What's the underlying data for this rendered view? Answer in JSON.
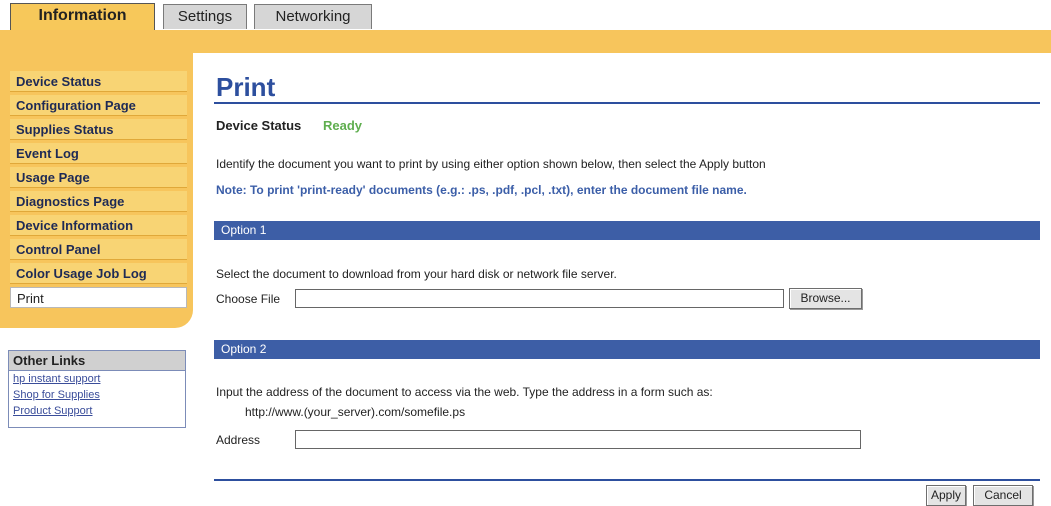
{
  "tabs": [
    {
      "label": "Information",
      "active": true
    },
    {
      "label": "Settings",
      "active": false
    },
    {
      "label": "Networking",
      "active": false
    }
  ],
  "sidebar": {
    "items": [
      {
        "label": "Device Status"
      },
      {
        "label": "Configuration Page"
      },
      {
        "label": "Supplies Status"
      },
      {
        "label": "Event Log"
      },
      {
        "label": "Usage Page"
      },
      {
        "label": "Diagnostics Page"
      },
      {
        "label": "Device Information"
      },
      {
        "label": "Control Panel"
      },
      {
        "label": "Color Usage Job Log"
      },
      {
        "label": "Print",
        "current": true
      }
    ]
  },
  "other_links": {
    "heading": "Other Links",
    "links": [
      "hp instant support",
      "Shop for Supplies",
      "Product Support"
    ]
  },
  "page": {
    "title": "Print",
    "status_label": "Device Status",
    "status_value": "Ready",
    "instructions": "Identify the document you want to print by using either option shown below, then select the Apply button",
    "note": "Note: To print 'print-ready' documents (e.g.: .ps, .pdf, .pcl, .txt), enter the document file name."
  },
  "option1": {
    "heading": "Option 1",
    "description": "Select the document to download from your hard disk or network file server.",
    "file_label": "Choose File",
    "file_value": "",
    "browse_label": "Browse..."
  },
  "option2": {
    "heading": "Option 2",
    "description": "Input the address of the document to access via the web. Type the address in a form such as:",
    "example": "http://www.(your_server).com/somefile.ps",
    "address_label": "Address",
    "address_value": ""
  },
  "actions": {
    "apply_label": "Apply",
    "cancel_label": "Cancel"
  },
  "colors": {
    "accent_blue": "#2d4f9e",
    "gold": "#f7c55c",
    "status_ready": "#5fae4f"
  }
}
